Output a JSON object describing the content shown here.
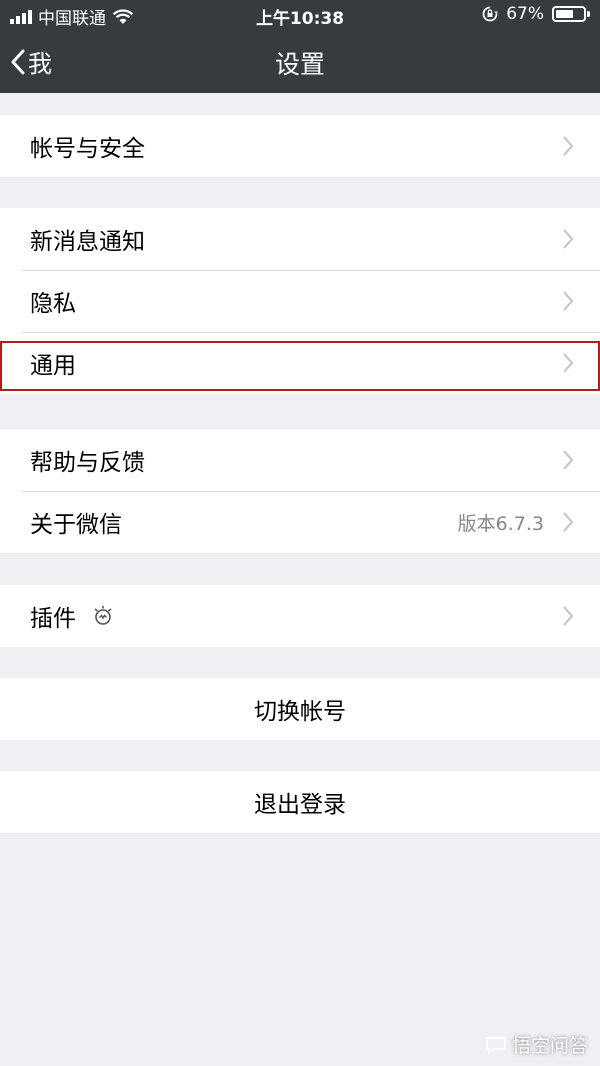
{
  "status_bar": {
    "carrier": "中国联通",
    "time": "上午10:38",
    "battery_percent": "67%",
    "battery_level": 0.67
  },
  "nav": {
    "back_label": "我",
    "title": "设置"
  },
  "groups": [
    {
      "items": [
        {
          "label": "帐号与安全"
        }
      ]
    },
    {
      "items": [
        {
          "label": "新消息通知"
        },
        {
          "label": "隐私"
        },
        {
          "label": "通用"
        }
      ]
    },
    {
      "items": [
        {
          "label": "帮助与反馈"
        },
        {
          "label": "关于微信",
          "detail": "版本6.7.3"
        }
      ]
    },
    {
      "items": [
        {
          "label": "插件"
        }
      ]
    }
  ],
  "actions": {
    "switch_account": "切换帐号",
    "logout": "退出登录"
  },
  "highlighted_item": "通用",
  "watermark": "悟空问答",
  "colors": {
    "nav_background": "#373a3f",
    "page_background": "#efeff4",
    "highlight_border": "#b21d1d"
  },
  "icons": {
    "back": "chevron-left-icon",
    "item_arrow": "chevron-right-icon",
    "plugin": "plugin-bulb-icon"
  }
}
